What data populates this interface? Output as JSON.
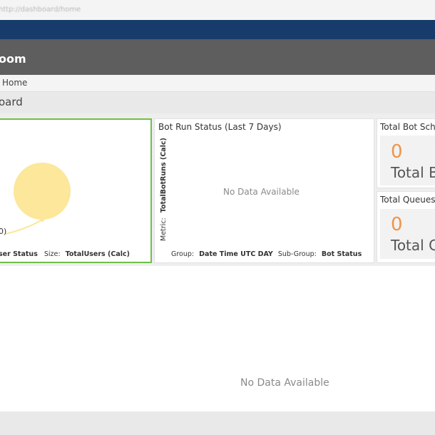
{
  "browser": {
    "url": "http://dashboard/home"
  },
  "app": {
    "title": "oom"
  },
  "breadcrumb": {
    "item": "Home"
  },
  "page": {
    "title": "oard"
  },
  "panels": {
    "bubble": {
      "legend_label": "ser Status",
      "size_label": "Size:",
      "size_value": "TotalUsers (Calc)",
      "bubble_color": "#fce79a",
      "edge_label": "0)"
    },
    "bot_run": {
      "title": "Bot Run Status (Last 7 Days)",
      "no_data": "No Data Available",
      "metric_label": "Metric:",
      "metric_value": "TotalBotRuns (Calc)",
      "group_label": "Group:",
      "group_value": "Date Time UTC DAY",
      "subgroup_label": "Sub-Group:",
      "subgroup_value": "Bot Status"
    },
    "total_bot_sch": {
      "title": "Total Bot Sch",
      "value": "0",
      "label": "Total B"
    },
    "total_queues": {
      "title": "Total Queues",
      "value": "0",
      "label": "Total C"
    },
    "bottom": {
      "no_data": "No Data Available"
    }
  },
  "colors": {
    "navy": "#173c6b",
    "accent_green": "#6fbf4a",
    "kpi_orange": "#f0944a"
  }
}
